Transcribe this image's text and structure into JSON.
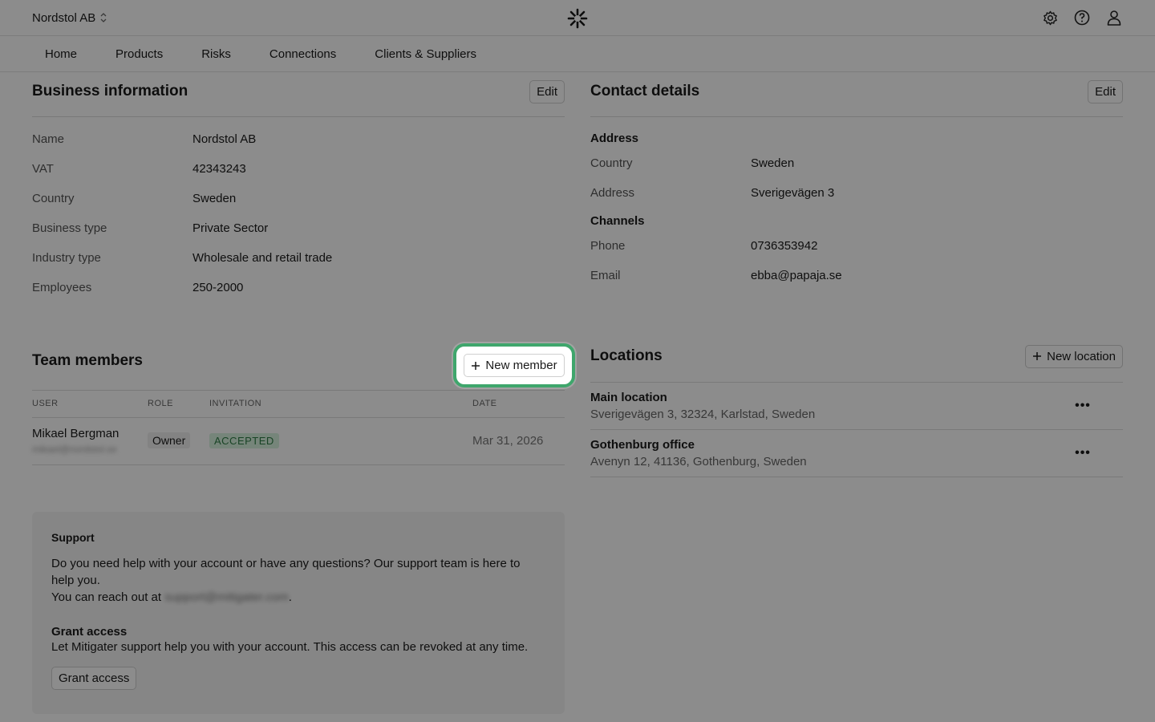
{
  "header": {
    "company": "Nordstol AB",
    "icons": [
      "settings-icon",
      "help-icon",
      "user-icon"
    ]
  },
  "nav": {
    "tabs": [
      "Home",
      "Products",
      "Risks",
      "Connections",
      "Clients & Suppliers"
    ]
  },
  "business": {
    "title": "Business information",
    "edit_label": "Edit",
    "rows": [
      {
        "label": "Name",
        "value": "Nordstol AB"
      },
      {
        "label": "VAT",
        "value": "42343243"
      },
      {
        "label": "Country",
        "value": "Sweden"
      },
      {
        "label": "Business type",
        "value": "Private Sector"
      },
      {
        "label": "Industry type",
        "value": "Wholesale and retail trade"
      },
      {
        "label": "Employees",
        "value": "250-2000"
      }
    ]
  },
  "contact": {
    "title": "Contact details",
    "edit_label": "Edit",
    "address_heading": "Address",
    "address_rows": [
      {
        "label": "Country",
        "value": "Sweden"
      },
      {
        "label": "Address",
        "value": "Sverigevägen 3"
      }
    ],
    "channels_heading": "Channels",
    "channel_rows": [
      {
        "label": "Phone",
        "value": "0736353942"
      },
      {
        "label": "Email",
        "value": "ebba@papaja.se"
      }
    ]
  },
  "team": {
    "title": "Team members",
    "new_member_label": "New member",
    "columns": [
      "USER",
      "ROLE",
      "INVITATION",
      "DATE"
    ],
    "members": [
      {
        "name": "Mikael Bergman",
        "email": "mikael@nordstol.se",
        "role": "Owner",
        "invitation": "ACCEPTED",
        "date": "Mar 31, 2026"
      }
    ]
  },
  "locations": {
    "title": "Locations",
    "new_location_label": "New location",
    "items": [
      {
        "name": "Main location",
        "address": "Sverigevägen 3, 32324, Karlstad, Sweden"
      },
      {
        "name": "Gothenburg office",
        "address": "Avenyn 12, 41136, Gothenburg, Sweden"
      }
    ]
  },
  "support": {
    "title": "Support",
    "text1": "Do you need help with your account or have any questions? Our support team is here to help you.",
    "text2_prefix": "You can reach out at",
    "email": "support@mitigater.com",
    "grant_title": "Grant access",
    "grant_text": "Let Mitigater support help you with your account. This access can be revoked at any time.",
    "grant_button": "Grant access"
  },
  "colors": {
    "highlight": "#3fa66c",
    "accepted_bg": "#d8f2de",
    "accepted_text": "#2f7d45"
  }
}
